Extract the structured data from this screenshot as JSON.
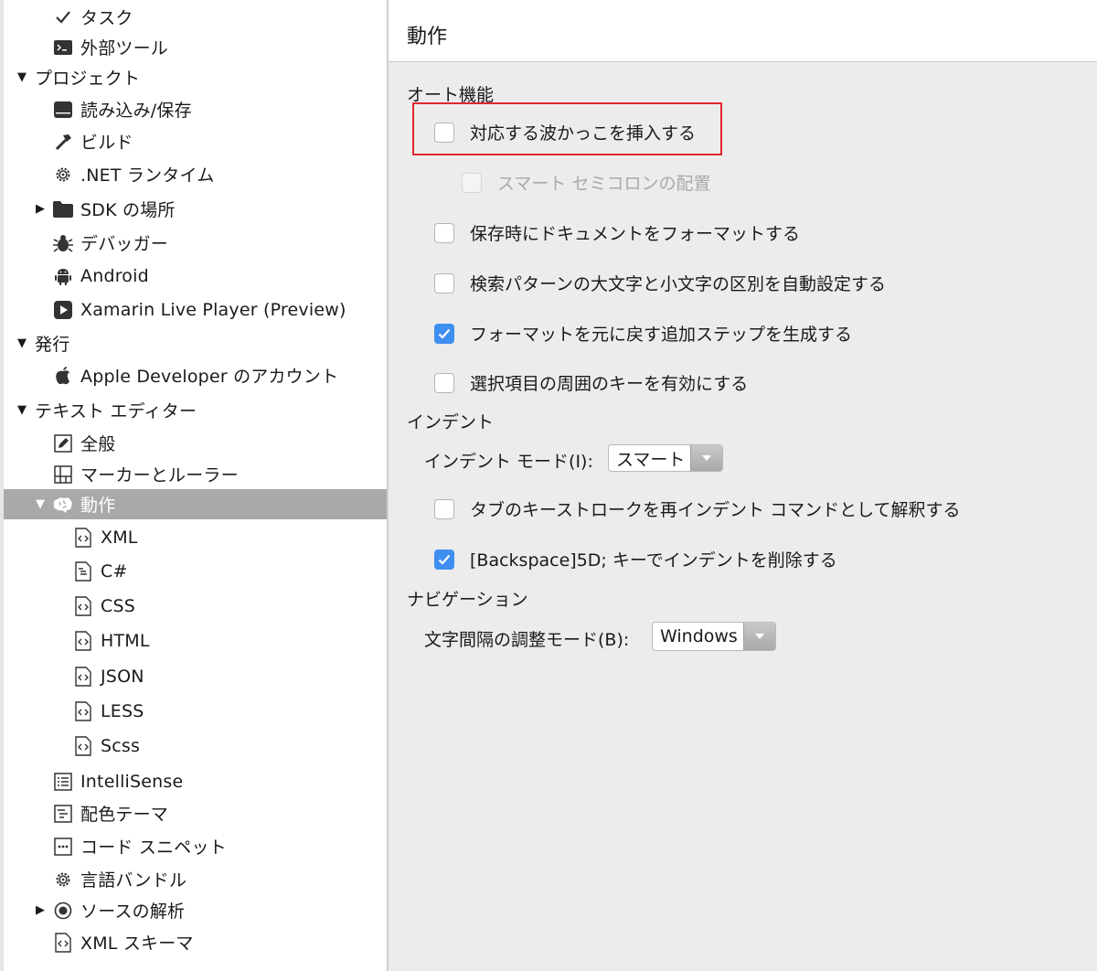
{
  "sidebar": {
    "items": [
      {
        "label": "タスク",
        "icon": "checkmark-icon",
        "indent": 1,
        "expander": "none"
      },
      {
        "label": "外部ツール",
        "icon": "terminal-icon",
        "indent": 1,
        "expander": "none"
      },
      {
        "label": "プロジェクト",
        "icon": "",
        "indent": 0,
        "expander": "expanded"
      },
      {
        "label": "読み込み/保存",
        "icon": "drive-icon",
        "indent": 1,
        "expander": "none"
      },
      {
        "label": "ビルド",
        "icon": "hammer-icon",
        "indent": 1,
        "expander": "none"
      },
      {
        "label": ".NET ランタイム",
        "icon": "gear-icon",
        "indent": 1,
        "expander": "none"
      },
      {
        "label": "SDK の場所",
        "icon": "folder-icon",
        "indent": 1,
        "expander": "collapsed"
      },
      {
        "label": "デバッガー",
        "icon": "bug-icon",
        "indent": 1,
        "expander": "none"
      },
      {
        "label": "Android",
        "icon": "android-icon",
        "indent": 1,
        "expander": "none"
      },
      {
        "label": "Xamarin Live Player (Preview)",
        "icon": "play-icon",
        "indent": 1,
        "expander": "none"
      },
      {
        "label": "発行",
        "icon": "",
        "indent": 0,
        "expander": "expanded"
      },
      {
        "label": "Apple Developer のアカウント",
        "icon": "apple-icon",
        "indent": 1,
        "expander": "none"
      },
      {
        "label": "テキスト エディター",
        "icon": "",
        "indent": 0,
        "expander": "expanded"
      },
      {
        "label": "全般",
        "icon": "pencil-icon",
        "indent": 1,
        "expander": "none"
      },
      {
        "label": "マーカーとルーラー",
        "icon": "grid-icon",
        "indent": 1,
        "expander": "none"
      },
      {
        "label": "動作",
        "icon": "brain-icon",
        "indent": 1,
        "expander": "expanded",
        "selected": true
      },
      {
        "label": "XML",
        "icon": "code-file-icon",
        "indent": 2,
        "expander": "none"
      },
      {
        "label": "C#",
        "icon": "csharp-file-icon",
        "indent": 2,
        "expander": "none"
      },
      {
        "label": "CSS",
        "icon": "code-file-icon",
        "indent": 2,
        "expander": "none"
      },
      {
        "label": "HTML",
        "icon": "code-file-icon",
        "indent": 2,
        "expander": "none"
      },
      {
        "label": "JSON",
        "icon": "code-file-icon",
        "indent": 2,
        "expander": "none"
      },
      {
        "label": "LESS",
        "icon": "code-file-icon",
        "indent": 2,
        "expander": "none"
      },
      {
        "label": "Scss",
        "icon": "code-file-icon",
        "indent": 2,
        "expander": "none"
      },
      {
        "label": "IntelliSense",
        "icon": "list-icon",
        "indent": 1,
        "expander": "none"
      },
      {
        "label": "配色テーマ",
        "icon": "theme-icon",
        "indent": 1,
        "expander": "none"
      },
      {
        "label": "コード スニペット",
        "icon": "snippet-icon",
        "indent": 1,
        "expander": "none"
      },
      {
        "label": "言語バンドル",
        "icon": "gear-icon",
        "indent": 1,
        "expander": "none"
      },
      {
        "label": "ソースの解析",
        "icon": "radio-icon",
        "indent": 1,
        "expander": "collapsed"
      },
      {
        "label": "XML スキーマ",
        "icon": "code-file-icon",
        "indent": 1,
        "expander": "none"
      }
    ]
  },
  "panel": {
    "title": "動作",
    "sections": {
      "auto": "オート機能",
      "indent": "インデント",
      "navigation": "ナビゲーション"
    },
    "options": {
      "insert_braces": {
        "label": "対応する波かっこを挿入する",
        "checked": false
      },
      "smart_semicolon": {
        "label": "スマート セミコロンの配置",
        "checked": false,
        "disabled": true
      },
      "format_on_save": {
        "label": "保存時にドキュメントをフォーマットする",
        "checked": false
      },
      "search_case": {
        "label": "検索パターンの大文字と小文字の区別を自動設定する",
        "checked": false
      },
      "undo_step": {
        "label": "フォーマットを元に戻す追加ステップを生成する",
        "checked": true
      },
      "surround_keys": {
        "label": "選択項目の周囲のキーを有効にする",
        "checked": false
      },
      "tab_reindent": {
        "label": "タブのキーストロークを再インデント コマンドとして解釈する",
        "checked": false
      },
      "backspace_unindent": {
        "label": "[Backspace]5D; キーでインデントを削除する",
        "checked": true
      }
    },
    "indent_mode": {
      "label": "インデント モード(I):",
      "value": "スマート"
    },
    "word_break": {
      "label": "文字間隔の調整モード(B):",
      "value": "Windows"
    }
  },
  "colors": {
    "accent": "#3f8ff0",
    "selection": "#a9a9a9",
    "highlight_box": "#e0282f"
  }
}
